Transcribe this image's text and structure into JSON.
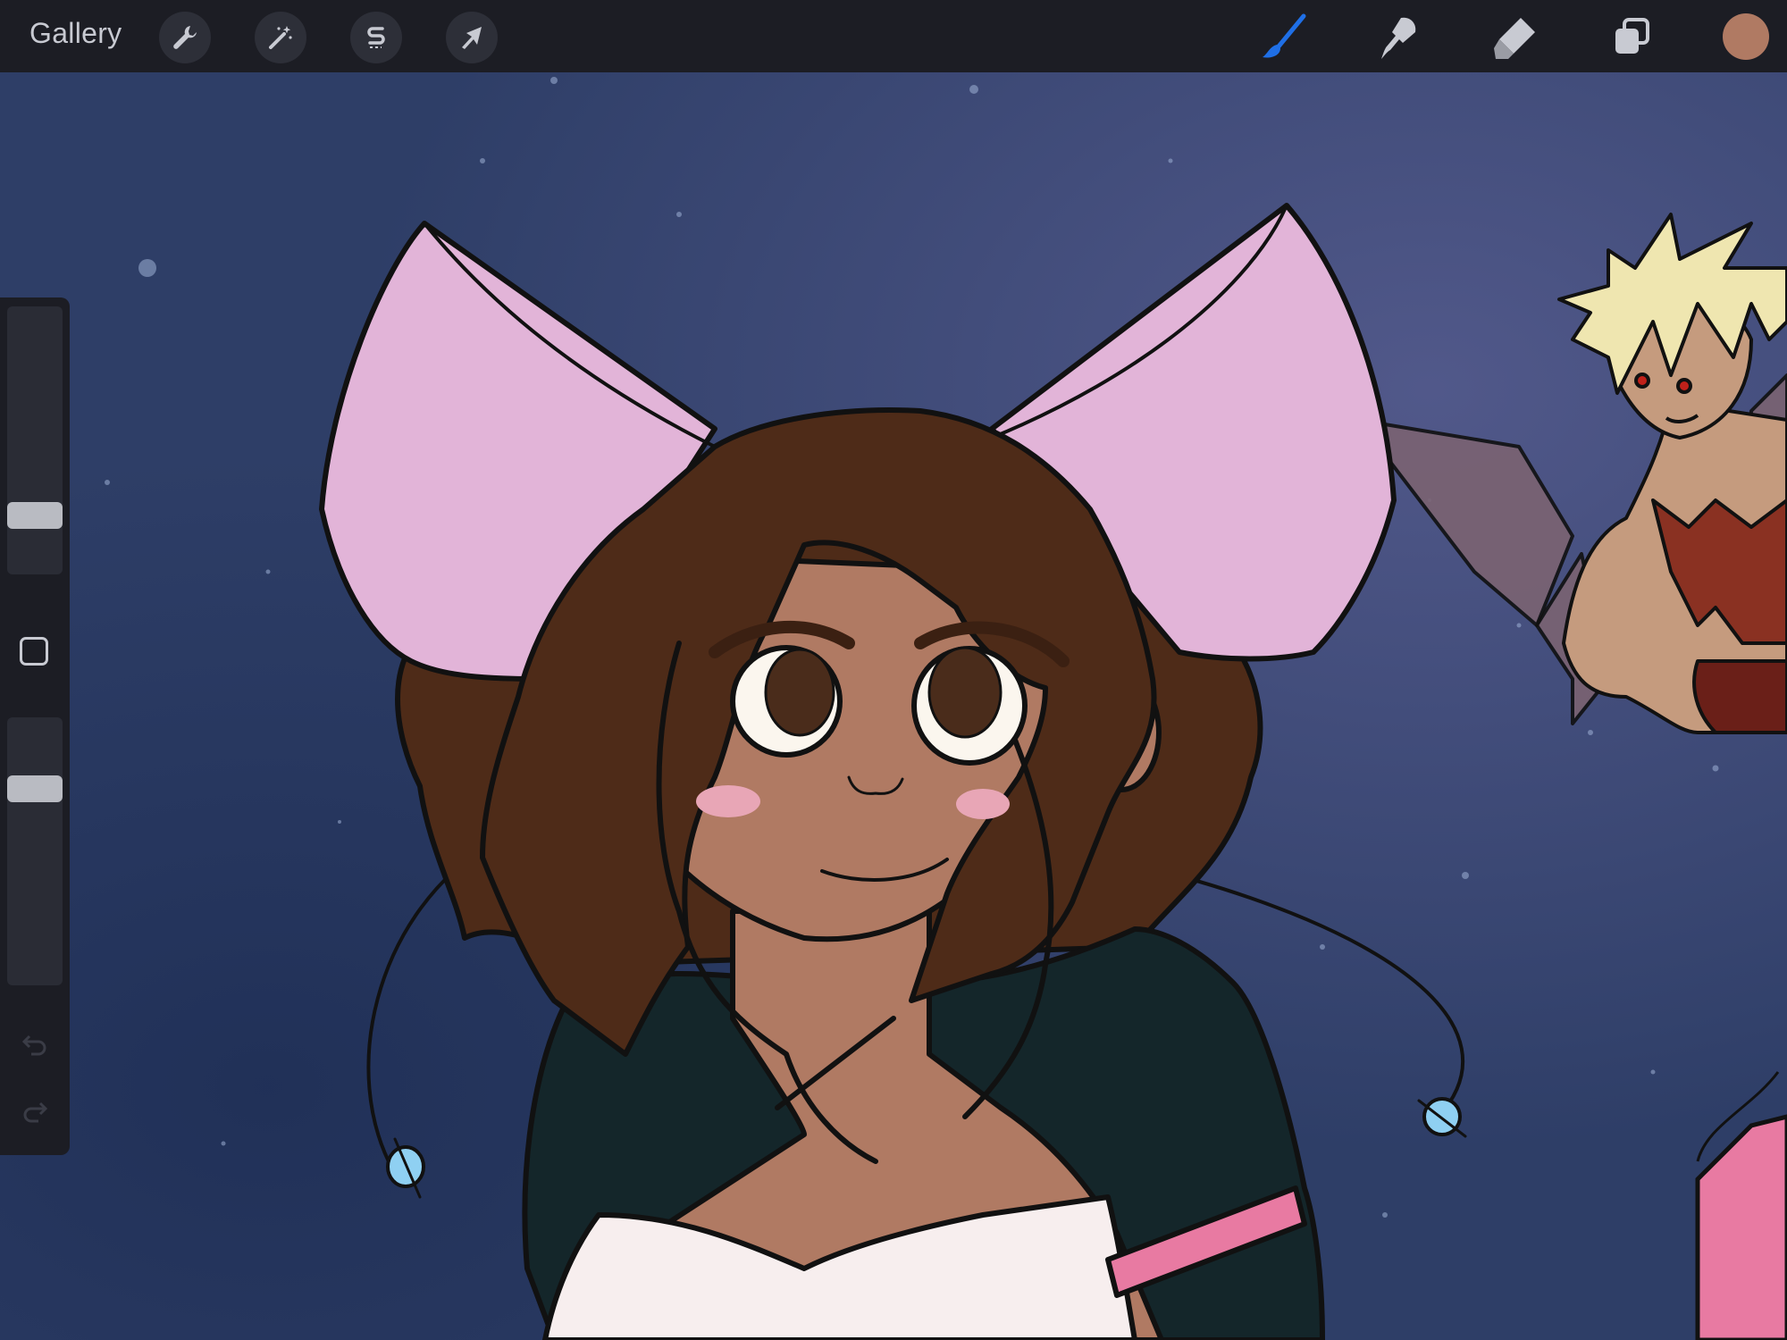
{
  "toolbar": {
    "gallery_label": "Gallery",
    "left_tools": [
      {
        "name": "actions",
        "icon": "wrench-icon"
      },
      {
        "name": "adjustments",
        "icon": "magic-wand-icon"
      },
      {
        "name": "selection",
        "icon": "selection-s-icon"
      },
      {
        "name": "transform",
        "icon": "arrow-cursor-icon"
      }
    ],
    "right_tools": [
      {
        "name": "brush",
        "icon": "brush-icon",
        "active": true
      },
      {
        "name": "smudge",
        "icon": "smudge-icon"
      },
      {
        "name": "eraser",
        "icon": "eraser-icon"
      },
      {
        "name": "layers",
        "icon": "layers-icon"
      }
    ],
    "active_color": "#b07a63",
    "accent_color": "#1f6fe6"
  },
  "sidebar": {
    "brush_size_level": 0.19,
    "opacity_level": 0.76,
    "tools": [
      "brush-size-slider",
      "modify-button",
      "opacity-slider",
      "undo-icon",
      "redo-icon"
    ]
  },
  "canvas": {
    "background_color": "#2f3f68",
    "content": "illustration"
  }
}
